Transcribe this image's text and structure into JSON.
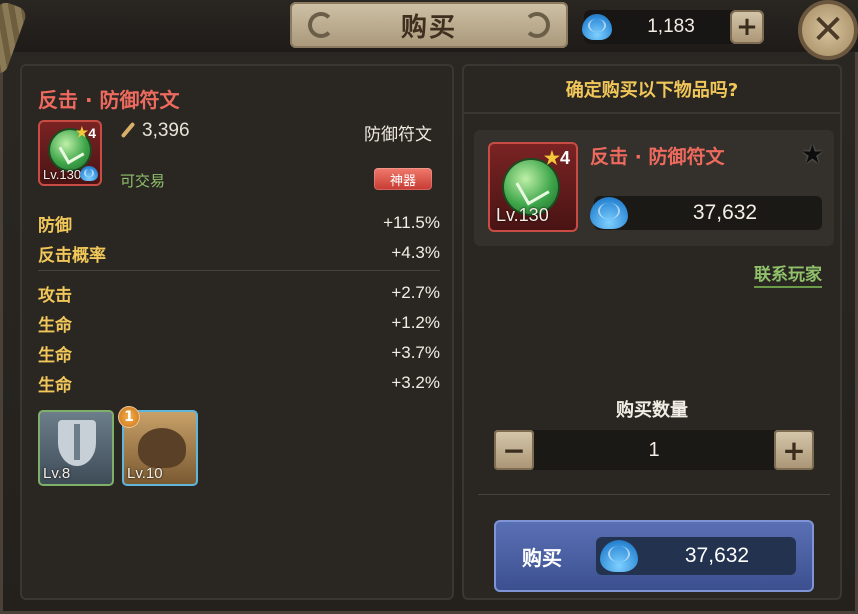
{
  "header": {
    "title": "购买",
    "currency_amount": "1,183",
    "add_label": "+"
  },
  "item": {
    "name": "反击 · 防御符文",
    "level": "Lv.130",
    "stars": "4",
    "power": "3,396",
    "type": "防御符文",
    "tradeable": "可交易",
    "artifact_badge": "神器",
    "main_stats": [
      {
        "name": "防御",
        "value": "+11.5%"
      },
      {
        "name": "反击概率",
        "value": "+4.3%"
      }
    ],
    "sub_stats": [
      {
        "name": "攻击",
        "value": "+2.7%"
      },
      {
        "name": "生命",
        "value": "+1.2%"
      },
      {
        "name": "生命",
        "value": "+3.7%"
      },
      {
        "name": "生命",
        "value": "+3.2%"
      }
    ],
    "skills": [
      {
        "level": "Lv.8",
        "icon": "shield-icon"
      },
      {
        "level": "Lv.10",
        "icon": "beast-icon",
        "badge": "1"
      }
    ]
  },
  "purchase": {
    "question": "确定购买以下物品吗?",
    "item_name": "反击 · 防御符文",
    "level": "Lv.130",
    "stars": "4",
    "price": "37,632",
    "contact": "联系玩家",
    "quantity_label": "购买数量",
    "quantity": "1",
    "minus": "−",
    "plus": "+",
    "buy_label": "购买",
    "total_price": "37,632"
  },
  "colors": {
    "item_name": "#ef6a5e",
    "stat_name": "#f1c75a",
    "tradeable": "#8fc06a",
    "buy_button": "#4a5fa2"
  }
}
